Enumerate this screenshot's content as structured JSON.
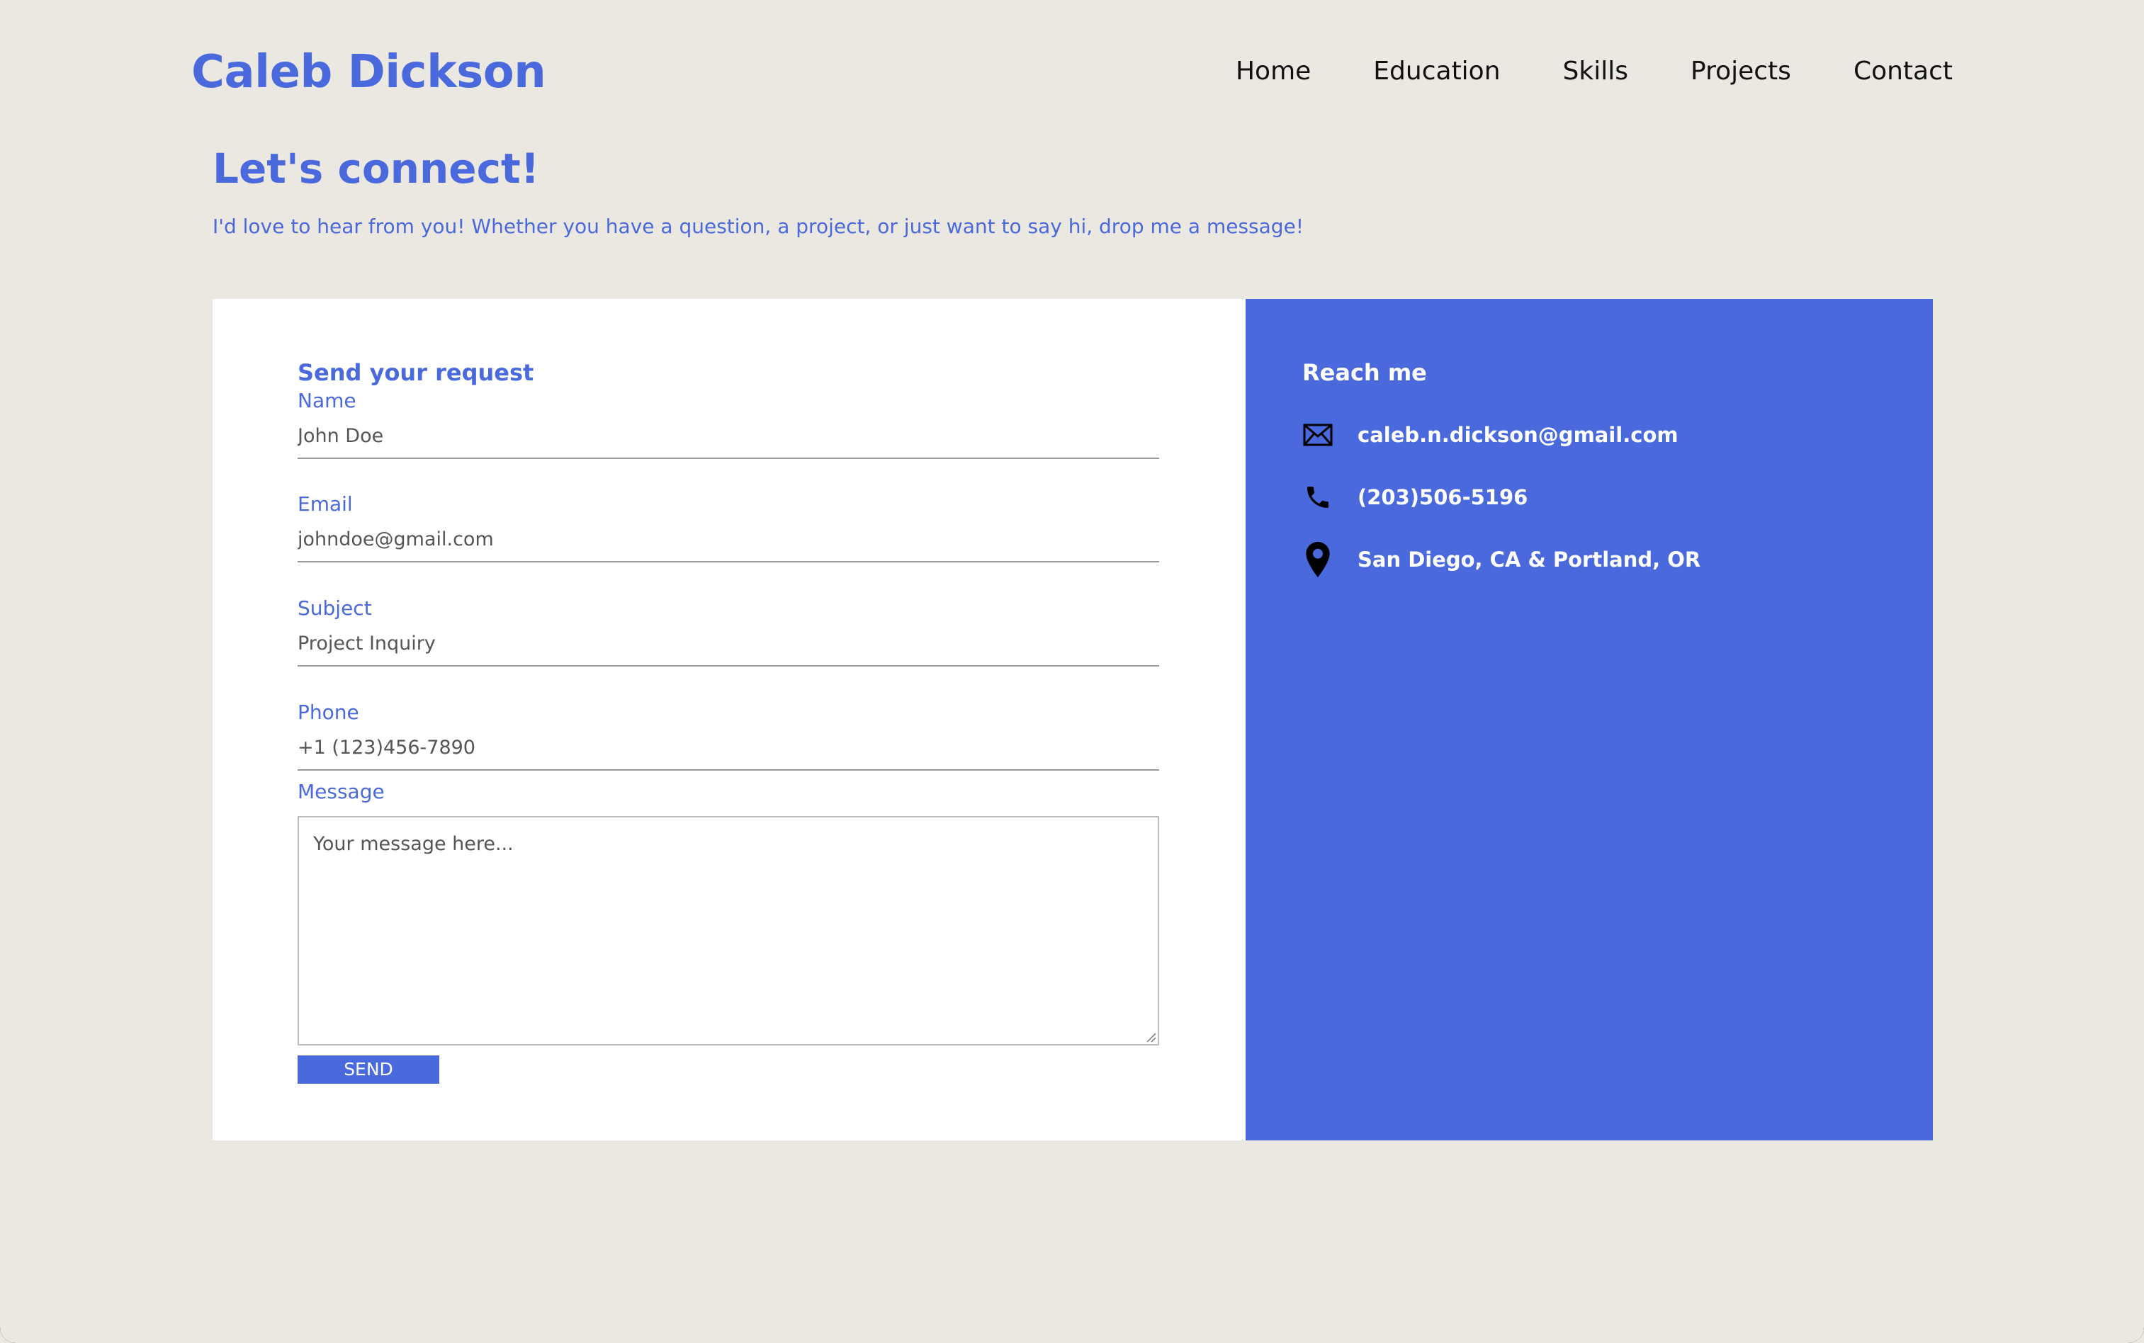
{
  "header": {
    "brand": "Caleb Dickson",
    "nav": [
      "Home",
      "Education",
      "Skills",
      "Projects",
      "Contact"
    ]
  },
  "hero": {
    "title": "Let's connect!",
    "subtitle": "I'd love to hear from you! Whether you have a question, a project, or just want to say hi, drop me a message!"
  },
  "form": {
    "title": "Send your request",
    "fields": [
      {
        "label": "Name",
        "placeholder": "John Doe"
      },
      {
        "label": "Email",
        "placeholder": "johndoe@gmail.com"
      },
      {
        "label": "Subject",
        "placeholder": "Project Inquiry"
      },
      {
        "label": "Phone",
        "placeholder": "+1 (123)456-7890"
      }
    ],
    "message_label": "Message",
    "message_placeholder": "Your message here...",
    "send_label": "SEND"
  },
  "reach": {
    "title": "Reach me",
    "items": [
      {
        "icon": "envelope-icon",
        "text": "caleb.n.dickson@gmail.com"
      },
      {
        "icon": "phone-icon",
        "text": "(203)506-5196"
      },
      {
        "icon": "location-pin-icon",
        "text": "San Diego, CA & Portland, OR"
      }
    ]
  },
  "colors": {
    "background": "#ebe7e1",
    "accent": "#4a69dc",
    "panel": "#ffffff"
  }
}
